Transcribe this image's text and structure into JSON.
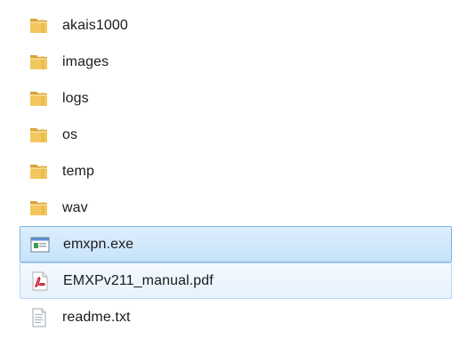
{
  "files": [
    {
      "name": "akais1000",
      "type": "folder",
      "icon": "folder-icon",
      "state": "normal"
    },
    {
      "name": "images",
      "type": "folder",
      "icon": "folder-icon",
      "state": "normal"
    },
    {
      "name": "logs",
      "type": "folder",
      "icon": "folder-icon",
      "state": "normal"
    },
    {
      "name": "os",
      "type": "folder",
      "icon": "folder-icon",
      "state": "normal"
    },
    {
      "name": "temp",
      "type": "folder",
      "icon": "folder-icon",
      "state": "normal"
    },
    {
      "name": "wav",
      "type": "folder",
      "icon": "folder-icon",
      "state": "normal"
    },
    {
      "name": "emxpn.exe",
      "type": "exe",
      "icon": "application-icon",
      "state": "selected"
    },
    {
      "name": "EMXPv211_manual.pdf",
      "type": "pdf",
      "icon": "pdf-icon",
      "state": "hover"
    },
    {
      "name": "readme.txt",
      "type": "txt",
      "icon": "text-file-icon",
      "state": "normal"
    }
  ],
  "colors": {
    "selection_fill": "#c7e3fa",
    "selection_border": "#7eb4e8",
    "hover_fill": "#e6f2fd",
    "hover_border": "#b8d6f3",
    "folder": "#e8b84a",
    "pdf": "#c8102e"
  }
}
